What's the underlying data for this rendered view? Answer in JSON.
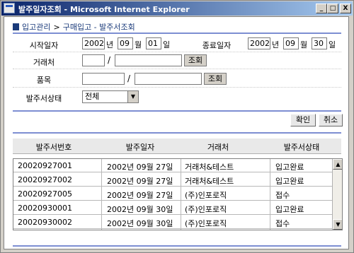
{
  "window": {
    "title": "발주일자조회 - Microsoft Internet Explorer",
    "minimize": "_",
    "maximize": "□",
    "close": "X"
  },
  "breadcrumb": {
    "section": "입고관리",
    "separator": ">",
    "page": "구매입고 - 발주서조회"
  },
  "form": {
    "start_date": {
      "label": "시작일자",
      "year": "2002",
      "year_unit": "년",
      "month": "09",
      "month_unit": "월",
      "day": "01",
      "day_unit": "일"
    },
    "end_date": {
      "label": "종료일자",
      "year": "2002",
      "year_unit": "년",
      "month": "09",
      "month_unit": "월",
      "day": "30",
      "day_unit": "일"
    },
    "vendor": {
      "label": "거래처",
      "code": "",
      "name": "",
      "separator": "/",
      "search_label": "조회"
    },
    "item": {
      "label": "품목",
      "code": "",
      "name": "",
      "separator": "/",
      "search_label": "조회"
    },
    "status": {
      "label": "발주서상태",
      "selected": "전체"
    }
  },
  "actions": {
    "confirm_label": "확인",
    "cancel_label": "취소"
  },
  "table": {
    "columns": [
      "발주서번호",
      "발주일자",
      "거래처",
      "발주서상태"
    ],
    "rows": [
      [
        "20020927001",
        "2002년 09월 27일",
        "거래처&테스트",
        "입고완료"
      ],
      [
        "20020927002",
        "2002년 09월 27일",
        "거래처&테스트",
        "입고완료"
      ],
      [
        "20020927005",
        "2002년 09월 27일",
        "(주)인포로직",
        "접수"
      ],
      [
        "20020930001",
        "2002년 09월 30일",
        "(주)인포로직",
        "입고완료"
      ],
      [
        "20020930002",
        "2002년 09월 30일",
        "(주)인포로직",
        "접수"
      ]
    ]
  },
  "scrollbar": {
    "up_icon": "▲",
    "down_icon": "▼"
  },
  "colors": {
    "titlebar_start": "#0a246a",
    "titlebar_end": "#a6caf0",
    "separator": "#7d8ed2",
    "breadcrumb": "#1a3a7a"
  }
}
